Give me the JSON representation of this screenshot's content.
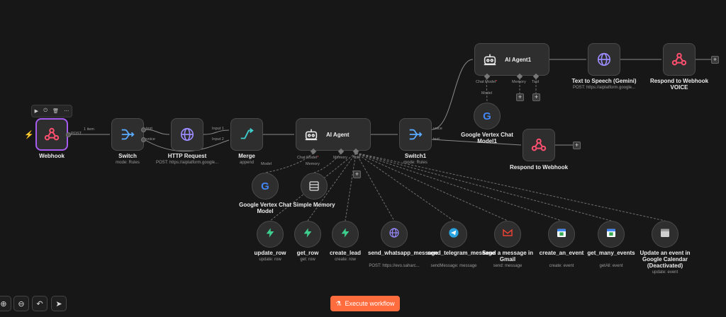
{
  "toolbar_mini": {
    "play": "▶",
    "power": "⏻",
    "trash": "🗑",
    "more": "⋯"
  },
  "nodes": {
    "webhook": {
      "label": "Webhook",
      "icon": "webhook-icon"
    },
    "switch": {
      "label": "Switch",
      "sub": "mode: Rules",
      "icon": "switch-icon"
    },
    "http": {
      "label": "HTTP Request",
      "sub": "POST: https://aiplatform.google...",
      "icon": "globe-icon"
    },
    "merge": {
      "label": "Merge",
      "sub": "append",
      "icon": "merge-icon"
    },
    "agent": {
      "label": "AI Agent",
      "icon": "robot-icon"
    },
    "switch1": {
      "label": "Switch1",
      "sub": "mode: Rules",
      "icon": "switch-icon"
    },
    "agent1": {
      "label": "AI Agent1",
      "icon": "robot-icon"
    },
    "tts": {
      "label": "Text to Speech (Gemini)",
      "sub": "POST: https://aiplatform.google...",
      "icon": "globe-icon"
    },
    "respond_voice": {
      "label": "Respond to Webhook VOICE",
      "icon": "webhook-icon"
    },
    "vertex1": {
      "label": "Google Vertex Chat Model1",
      "icon": "google-icon"
    },
    "respond": {
      "label": "Respond to Webhook",
      "icon": "webhook-icon"
    },
    "vertex": {
      "label": "Google Vertex Chat Model",
      "icon": "google-icon"
    },
    "memory": {
      "label": "Simple Memory",
      "icon": "memory-icon"
    }
  },
  "tools": [
    {
      "label": "update_row",
      "sub": "update: row",
      "icon": "supabase-icon"
    },
    {
      "label": "get_row",
      "sub": "get: row",
      "icon": "supabase-icon"
    },
    {
      "label": "create_lead",
      "sub": "create: row",
      "icon": "supabase-icon"
    },
    {
      "label": "send_whatsapp_message",
      "sub": "POST: https://evo.saharc...",
      "icon": "globe-icon"
    },
    {
      "label": "send_telegram_message",
      "sub": "sendMessage: message",
      "icon": "telegram-icon"
    },
    {
      "label": "Send a message in Gmail",
      "sub": "send: message",
      "icon": "gmail-icon"
    },
    {
      "label": "create_an_event",
      "sub": "create: event",
      "icon": "calendar-icon"
    },
    {
      "label": "get_many_events",
      "sub": "getAll: event",
      "icon": "calendar-icon"
    },
    {
      "label": "Update an event in Google Calendar (Deactivated)",
      "sub": "update: event",
      "icon": "calendar-deactivated-icon"
    }
  ],
  "edge_labels": {
    "webhook_out": "POST",
    "items": "1 item",
    "switch_text": "text",
    "switch_voice": "voice",
    "merge_in1": "Input 1",
    "merge_in2": "Input 2",
    "switch1_voice": "voice",
    "switch1_text": "text"
  },
  "ports": {
    "chat_model": "Chat Model",
    "memory": "Memory",
    "tool": "Tool",
    "model": "Model"
  },
  "execute": {
    "label": "Execute workflow"
  },
  "colors": {
    "accent": "#ff6d3f",
    "selected": "#a75cf0",
    "webhook": "#ff4f6f",
    "supabase": "#3ecf8e",
    "globe": "#9a8cff",
    "telegram": "#2aa3e0"
  }
}
